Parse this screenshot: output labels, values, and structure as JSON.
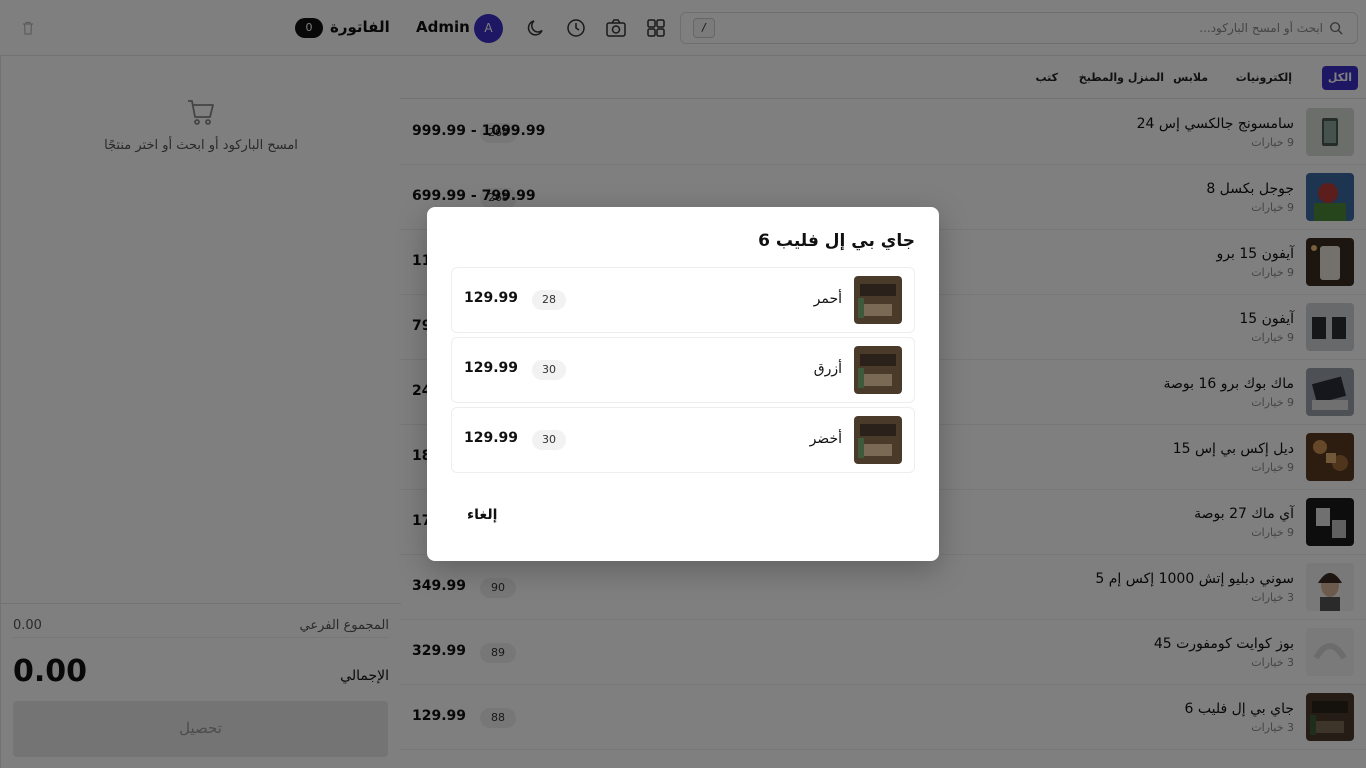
{
  "header": {
    "search_placeholder": "ابحث أو امسح الباركود...",
    "search_shortcut": "/",
    "user_name": "Admin",
    "user_initial": "A",
    "invoice_title": "الفاتورة",
    "invoice_count": "0",
    "icons": [
      "search-icon",
      "grid-icon",
      "camera-icon",
      "clock-icon",
      "moon-icon",
      "trash-icon"
    ]
  },
  "cart": {
    "empty_text": "امسح الباركود أو ابحث أو اختر منتجًا",
    "subtotal_label": "المجموع الفرعي",
    "subtotal_value": "0.00",
    "total_label": "الإجمالي",
    "total_value": "0.00",
    "pay_label": "تحصيل"
  },
  "categories": [
    {
      "label": "الكل",
      "active": true
    },
    {
      "label": "إلكترونيات",
      "active": false
    },
    {
      "label": "ملابس",
      "active": false
    },
    {
      "label": "المنزل والمطبخ",
      "active": false
    },
    {
      "label": "كتب",
      "active": false
    }
  ],
  "products": [
    {
      "name": "سامسونج جالكسي إس 24",
      "options": "9 خيارات",
      "stock": "269",
      "price": "999.99 - 1099.99"
    },
    {
      "name": "جوجل بكسل 8",
      "options": "9 خيارات",
      "stock": "269",
      "price": "699.99 - 799.99"
    },
    {
      "name": "آيفون 15 برو",
      "options": "9 خيارات",
      "stock": "",
      "price": "11"
    },
    {
      "name": "آيفون 15",
      "options": "9 خيارات",
      "stock": "",
      "price": "79"
    },
    {
      "name": "ماك بوك برو 16 بوصة",
      "options": "9 خيارات",
      "stock": "",
      "price": "24"
    },
    {
      "name": "ديل إكس بي إس 15",
      "options": "9 خيارات",
      "stock": "",
      "price": "18"
    },
    {
      "name": "آي ماك 27 بوصة",
      "options": "9 خيارات",
      "stock": "",
      "price": "17"
    },
    {
      "name": "سوني دبليو إتش 1000 إكس إم 5",
      "options": "3 خيارات",
      "stock": "90",
      "price": "349.99"
    },
    {
      "name": "بوز كوايت كومفورت 45",
      "options": "3 خيارات",
      "stock": "89",
      "price": "329.99"
    },
    {
      "name": "جاي بي إل فليب 6",
      "options": "3 خيارات",
      "stock": "88",
      "price": "129.99"
    }
  ],
  "modal": {
    "title": "جاي بي إل فليب 6",
    "variants": [
      {
        "name": "أحمر",
        "stock": "28",
        "price": "129.99"
      },
      {
        "name": "أزرق",
        "stock": "30",
        "price": "129.99"
      },
      {
        "name": "أخضر",
        "stock": "30",
        "price": "129.99"
      }
    ],
    "cancel_label": "إلغاء"
  },
  "colors": {
    "accent": "#3b2fc9",
    "overlay": "rgba(0,0,0,0.5)"
  }
}
